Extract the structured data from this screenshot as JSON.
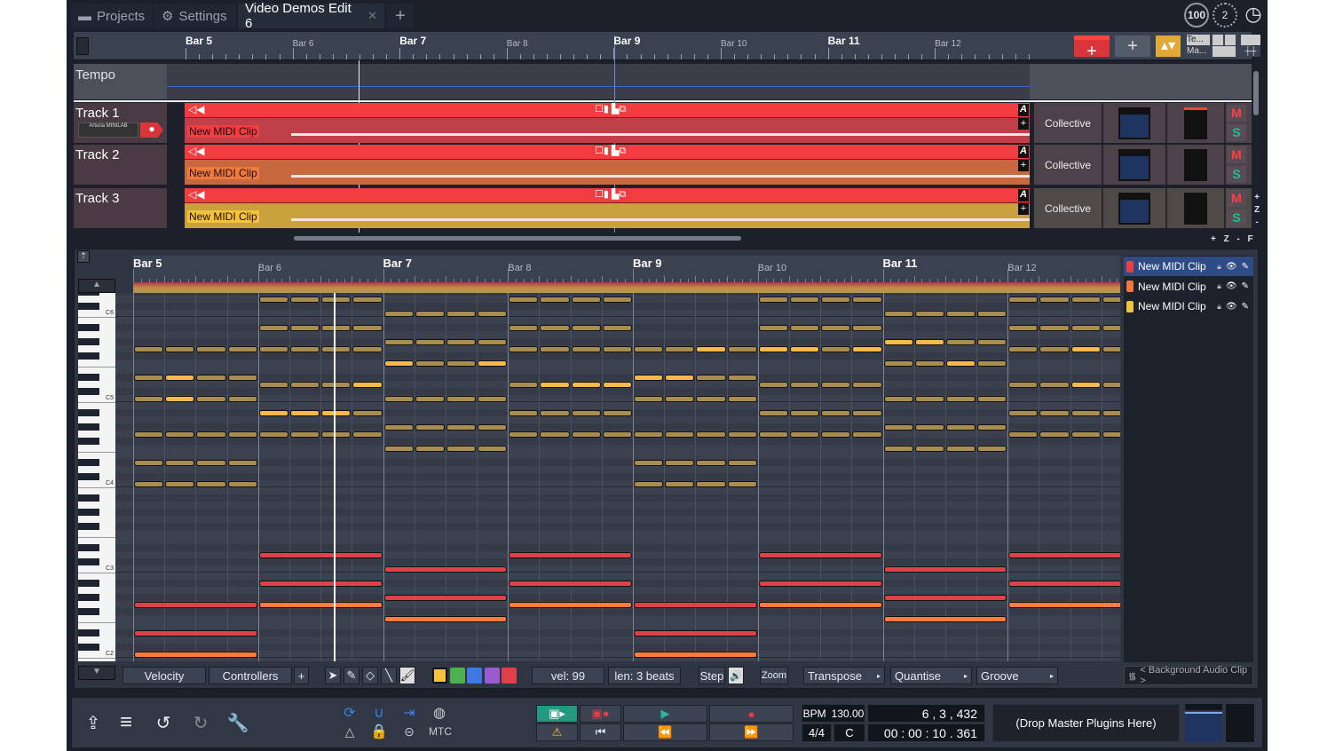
{
  "tabs": [
    {
      "label": "Projects",
      "icon": "folder-icon"
    },
    {
      "label": "Settings",
      "icon": "gear-icon"
    },
    {
      "label": "Video Demos Edit 6",
      "icon": "close-icon",
      "active": true
    }
  ],
  "top_right": {
    "cpu": "100",
    "counter": "2",
    "clock": "clock-icon"
  },
  "toolbar_right": {
    "te": "Te...",
    "ma": "Ma..."
  },
  "arrange": {
    "bars": [
      {
        "label": "Bar 5",
        "major": true
      },
      {
        "label": "Bar 6"
      },
      {
        "label": "Bar 7",
        "major": true
      },
      {
        "label": "Bar 8"
      },
      {
        "label": "Bar 9",
        "major": true
      },
      {
        "label": "Bar 10"
      },
      {
        "label": "Bar 11",
        "major": true
      },
      {
        "label": "Bar 12"
      }
    ],
    "tempo_label": "Tempo",
    "tracks": [
      {
        "name": "Track 1",
        "input": "Arturia MINILAB",
        "clip": "New MIDI Clip",
        "plugin": "Collective",
        "color": "#c0404a",
        "label_bg": "#f23c40"
      },
      {
        "name": "Track 2",
        "clip": "New MIDI Clip",
        "plugin": "Collective",
        "color": "#c8683e",
        "label_bg": "#f07a3c"
      },
      {
        "name": "Track 3",
        "clip": "New MIDI Clip",
        "plugin": "Collective",
        "color": "#c9a23e",
        "label_bg": "#f2c23c"
      }
    ],
    "mute": "M",
    "solo": "S",
    "auto": "A",
    "plus": "+",
    "zoom_controls": [
      "+",
      "Z",
      "-",
      "F"
    ]
  },
  "piano_roll": {
    "bars": [
      {
        "label": "Bar 5",
        "major": true
      },
      {
        "label": "Bar 6"
      },
      {
        "label": "Bar 7",
        "major": true
      },
      {
        "label": "Bar 8"
      },
      {
        "label": "Bar 9",
        "major": true
      },
      {
        "label": "Bar 10"
      },
      {
        "label": "Bar 11",
        "major": true
      },
      {
        "label": "Bar 12"
      }
    ],
    "octave_labels": [
      "C6",
      "C5",
      "C4",
      "C3",
      "C2"
    ],
    "colors": {
      "gold": "#a88c50",
      "gold_selected": "#f4b94a",
      "red": "#e0404a",
      "orange": "#ff7a3d"
    },
    "gold_notes": [
      {
        "bar": 5,
        "pitch": 79,
        "bright": []
      },
      {
        "bar": 5,
        "pitch": 75,
        "bright": [
          2
        ]
      },
      {
        "bar": 5,
        "pitch": 72,
        "bright": [
          2
        ]
      },
      {
        "bar": 5,
        "pitch": 67,
        "bright": []
      },
      {
        "bar": 5,
        "pitch": 63,
        "bright": []
      },
      {
        "bar": 5,
        "pitch": 60,
        "bright": []
      },
      {
        "bar": 6,
        "pitch": 86,
        "bright": []
      },
      {
        "bar": 6,
        "pitch": 82,
        "bright": []
      },
      {
        "bar": 6,
        "pitch": 79,
        "bright": []
      },
      {
        "bar": 6,
        "pitch": 74,
        "bright": [
          4
        ]
      },
      {
        "bar": 6,
        "pitch": 70,
        "bright": [
          1,
          2,
          3
        ]
      },
      {
        "bar": 6,
        "pitch": 67,
        "bright": []
      },
      {
        "bar": 7,
        "pitch": 84,
        "bright": []
      },
      {
        "bar": 7,
        "pitch": 80,
        "bright": []
      },
      {
        "bar": 7,
        "pitch": 77,
        "bright": [
          1,
          4
        ]
      },
      {
        "bar": 7,
        "pitch": 72,
        "bright": []
      },
      {
        "bar": 7,
        "pitch": 68,
        "bright": []
      },
      {
        "bar": 7,
        "pitch": 65,
        "bright": []
      },
      {
        "bar": 8,
        "pitch": 86,
        "bright": []
      },
      {
        "bar": 8,
        "pitch": 82,
        "bright": []
      },
      {
        "bar": 8,
        "pitch": 79,
        "bright": []
      },
      {
        "bar": 8,
        "pitch": 74,
        "bright": [
          2,
          3,
          4
        ]
      },
      {
        "bar": 8,
        "pitch": 70,
        "bright": []
      },
      {
        "bar": 8,
        "pitch": 67,
        "bright": []
      },
      {
        "bar": 9,
        "pitch": 79,
        "bright": [
          3
        ]
      },
      {
        "bar": 9,
        "pitch": 75,
        "bright": [
          1,
          2
        ]
      },
      {
        "bar": 9,
        "pitch": 72,
        "bright": []
      },
      {
        "bar": 9,
        "pitch": 67,
        "bright": []
      },
      {
        "bar": 9,
        "pitch": 63,
        "bright": []
      },
      {
        "bar": 9,
        "pitch": 60,
        "bright": []
      },
      {
        "bar": 10,
        "pitch": 86,
        "bright": []
      },
      {
        "bar": 10,
        "pitch": 82,
        "bright": []
      },
      {
        "bar": 10,
        "pitch": 79,
        "bright": [
          1,
          2,
          4
        ]
      },
      {
        "bar": 10,
        "pitch": 74,
        "bright": []
      },
      {
        "bar": 10,
        "pitch": 70,
        "bright": []
      },
      {
        "bar": 10,
        "pitch": 67,
        "bright": []
      },
      {
        "bar": 11,
        "pitch": 84,
        "bright": []
      },
      {
        "bar": 11,
        "pitch": 80,
        "bright": [
          1,
          2
        ]
      },
      {
        "bar": 11,
        "pitch": 77,
        "bright": [
          3
        ]
      },
      {
        "bar": 11,
        "pitch": 72,
        "bright": []
      },
      {
        "bar": 11,
        "pitch": 68,
        "bright": []
      },
      {
        "bar": 11,
        "pitch": 65,
        "bright": []
      },
      {
        "bar": 12,
        "pitch": 86,
        "bright": []
      },
      {
        "bar": 12,
        "pitch": 82,
        "bright": []
      },
      {
        "bar": 12,
        "pitch": 79,
        "bright": [
          3
        ]
      },
      {
        "bar": 12,
        "pitch": 74,
        "bright": [
          3
        ]
      },
      {
        "bar": 12,
        "pitch": 70,
        "bright": []
      },
      {
        "bar": 12,
        "pitch": 67,
        "bright": []
      }
    ],
    "bass_notes": [
      {
        "bar": 5,
        "pitches": [
          43,
          39
        ],
        "orange": 36
      },
      {
        "bar": 6,
        "pitches": [
          50,
          46
        ],
        "orange": 43
      },
      {
        "bar": 7,
        "pitches": [
          48,
          44
        ],
        "orange": 41
      },
      {
        "bar": 8,
        "pitches": [
          50,
          46
        ],
        "orange": 43
      },
      {
        "bar": 9,
        "pitches": [
          43,
          39
        ],
        "orange": 36
      },
      {
        "bar": 10,
        "pitches": [
          50,
          46
        ],
        "orange": 43
      },
      {
        "bar": 11,
        "pitches": [
          48,
          44
        ],
        "orange": 41
      },
      {
        "bar": 12,
        "pitches": [
          50,
          46
        ],
        "orange": 43
      }
    ],
    "clip_list": [
      {
        "name": "New MIDI Clip",
        "color": "#f23c40",
        "selected": true
      },
      {
        "name": "New MIDI Clip",
        "color": "#f07a3c"
      },
      {
        "name": "New MIDI Clip",
        "color": "#f2c23c"
      }
    ],
    "background_clip": "< Background Audio Clip >",
    "toolbar": {
      "velocity": "Velocity",
      "controllers": "Controllers",
      "add": "+",
      "vel": "vel: 99",
      "len": "len: 3 beats",
      "step": "Step",
      "zoom": "Zoom",
      "transpose": "Transpose",
      "quantise": "Quantise",
      "groove": "Groove",
      "swatches": [
        "#f4c23c",
        "#4caf50",
        "#3f78e0",
        "#9a5ad0",
        "#e0404a"
      ]
    }
  },
  "transport": {
    "bpm_label": "BPM",
    "bpm": "130.00",
    "position": "6 ,  3  , 432",
    "time_sig": "4/4",
    "key": "C",
    "time": "00 : 00 : 10 . 361",
    "master": "(Drop Master Plugins Here)",
    "mtc": "MTC"
  }
}
